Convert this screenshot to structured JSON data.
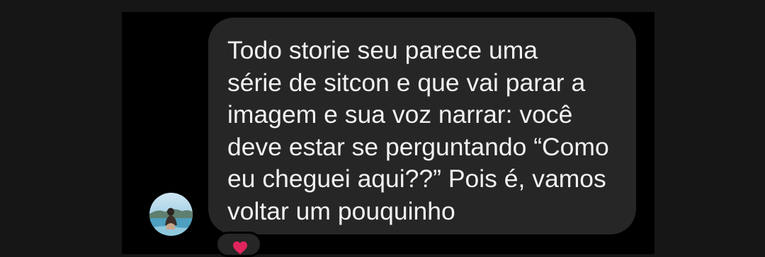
{
  "message": {
    "text": "Todo storie seu parece uma\nsérie de sitcon e que vai parar a\nimagem e sua voz narrar: você\ndeve estar se perguntando “Como\neu cheguei aqui??” Pois é, vamos\nvoltar um pouquinho"
  },
  "reaction": {
    "icon": "heart-icon",
    "color": "#e0245e"
  },
  "colors": {
    "background": "#161616",
    "chat_background": "#000000",
    "bubble": "#262626",
    "text": "#f2f2f2"
  }
}
